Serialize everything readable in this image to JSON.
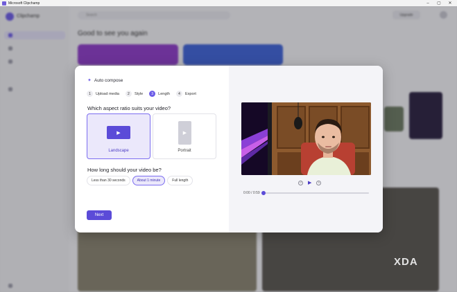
{
  "window": {
    "title": "Microsoft Clipchamp"
  },
  "background": {
    "logo_text": "Clipchamp",
    "search_placeholder": "Search",
    "upgrade_label": "Upgrade",
    "greeting": "Good to see you again"
  },
  "modal": {
    "heading": "Auto compose",
    "steps": [
      {
        "num": "1",
        "label": "Upload media"
      },
      {
        "num": "2",
        "label": "Style"
      },
      {
        "num": "3",
        "label": "Length"
      },
      {
        "num": "4",
        "label": "Export"
      }
    ],
    "current_step": 3,
    "aspect_question": "Which aspect ratio suits your video?",
    "aspects": [
      {
        "label": "Landscape",
        "selected": true
      },
      {
        "label": "Portrait",
        "selected": false
      }
    ],
    "length_question": "How long should your video be?",
    "lengths": [
      {
        "label": "Less than 30 seconds",
        "selected": false
      },
      {
        "label": "About 1 minute",
        "selected": true
      },
      {
        "label": "Full length",
        "selected": false
      }
    ],
    "next_label": "Next"
  },
  "preview": {
    "time": "0:00 / 0:59",
    "progress": 0.0
  },
  "watermark": "XDA",
  "colors": {
    "accent": "#5b4bd8",
    "accent_light": "#ebe8fb"
  }
}
